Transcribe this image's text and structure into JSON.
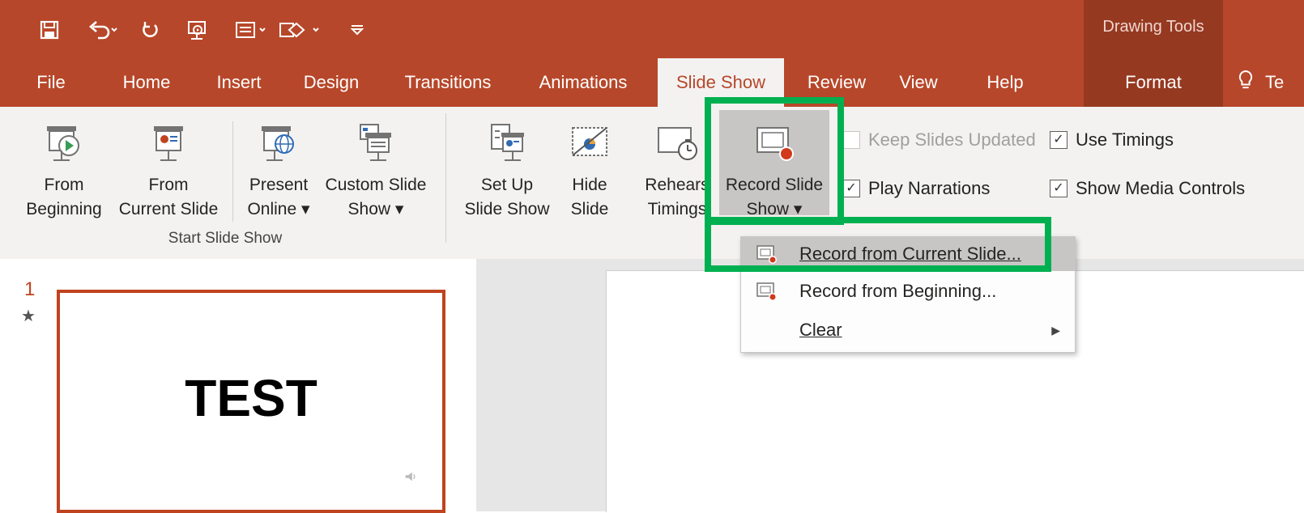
{
  "colors": {
    "accent": "#b7472a",
    "context_tab": "#963921",
    "highlight_box": "#00b050"
  },
  "quick_access": [
    {
      "icon": "save-icon"
    },
    {
      "icon": "undo-icon"
    },
    {
      "icon": "repeat-icon"
    },
    {
      "icon": "start-presentation-icon"
    },
    {
      "icon": "layout-icon"
    },
    {
      "icon": "shape-icon"
    },
    {
      "icon": "customize-qat-icon"
    }
  ],
  "context_tab_label": "Drawing Tools",
  "tabs": [
    "File",
    "Home",
    "Insert",
    "Design",
    "Transitions",
    "Animations",
    "Slide Show",
    "Review",
    "View",
    "Help",
    "Format"
  ],
  "active_tab": "Slide Show",
  "tell_me": "Te",
  "ribbon": {
    "buttons": [
      {
        "line1": "From",
        "line2": "Beginning"
      },
      {
        "line1": "From",
        "line2": "Current Slide"
      },
      {
        "line1": "Present",
        "line2": "Online ▾"
      },
      {
        "line1": "Custom Slide",
        "line2": "Show ▾"
      },
      {
        "line1": "Set Up",
        "line2": "Slide Show"
      },
      {
        "line1": "Hide",
        "line2": "Slide"
      },
      {
        "line1": "Rehears",
        "line2": "Timings"
      },
      {
        "line1": "Record Slide",
        "line2": "Show ▾"
      }
    ],
    "group_label": "Start Slide Show",
    "checkboxes": [
      {
        "label": "Keep Slides Updated",
        "checked": false,
        "enabled": false
      },
      {
        "label": "Play Narrations",
        "checked": true,
        "enabled": true
      },
      {
        "label": "Use Timings",
        "checked": true,
        "enabled": true
      },
      {
        "label": "Show Media Controls",
        "checked": true,
        "enabled": true
      }
    ]
  },
  "dropdown_menu": [
    {
      "label": "Record from Current Slide...",
      "highlighted": true,
      "has_submenu": false
    },
    {
      "label": "Record from Beginning...",
      "highlighted": false,
      "has_submenu": false
    },
    {
      "label": "Clear",
      "highlighted": false,
      "has_submenu": true
    }
  ],
  "slide_panel": {
    "number": "1",
    "star": "★",
    "thumb_text": "TEST"
  }
}
